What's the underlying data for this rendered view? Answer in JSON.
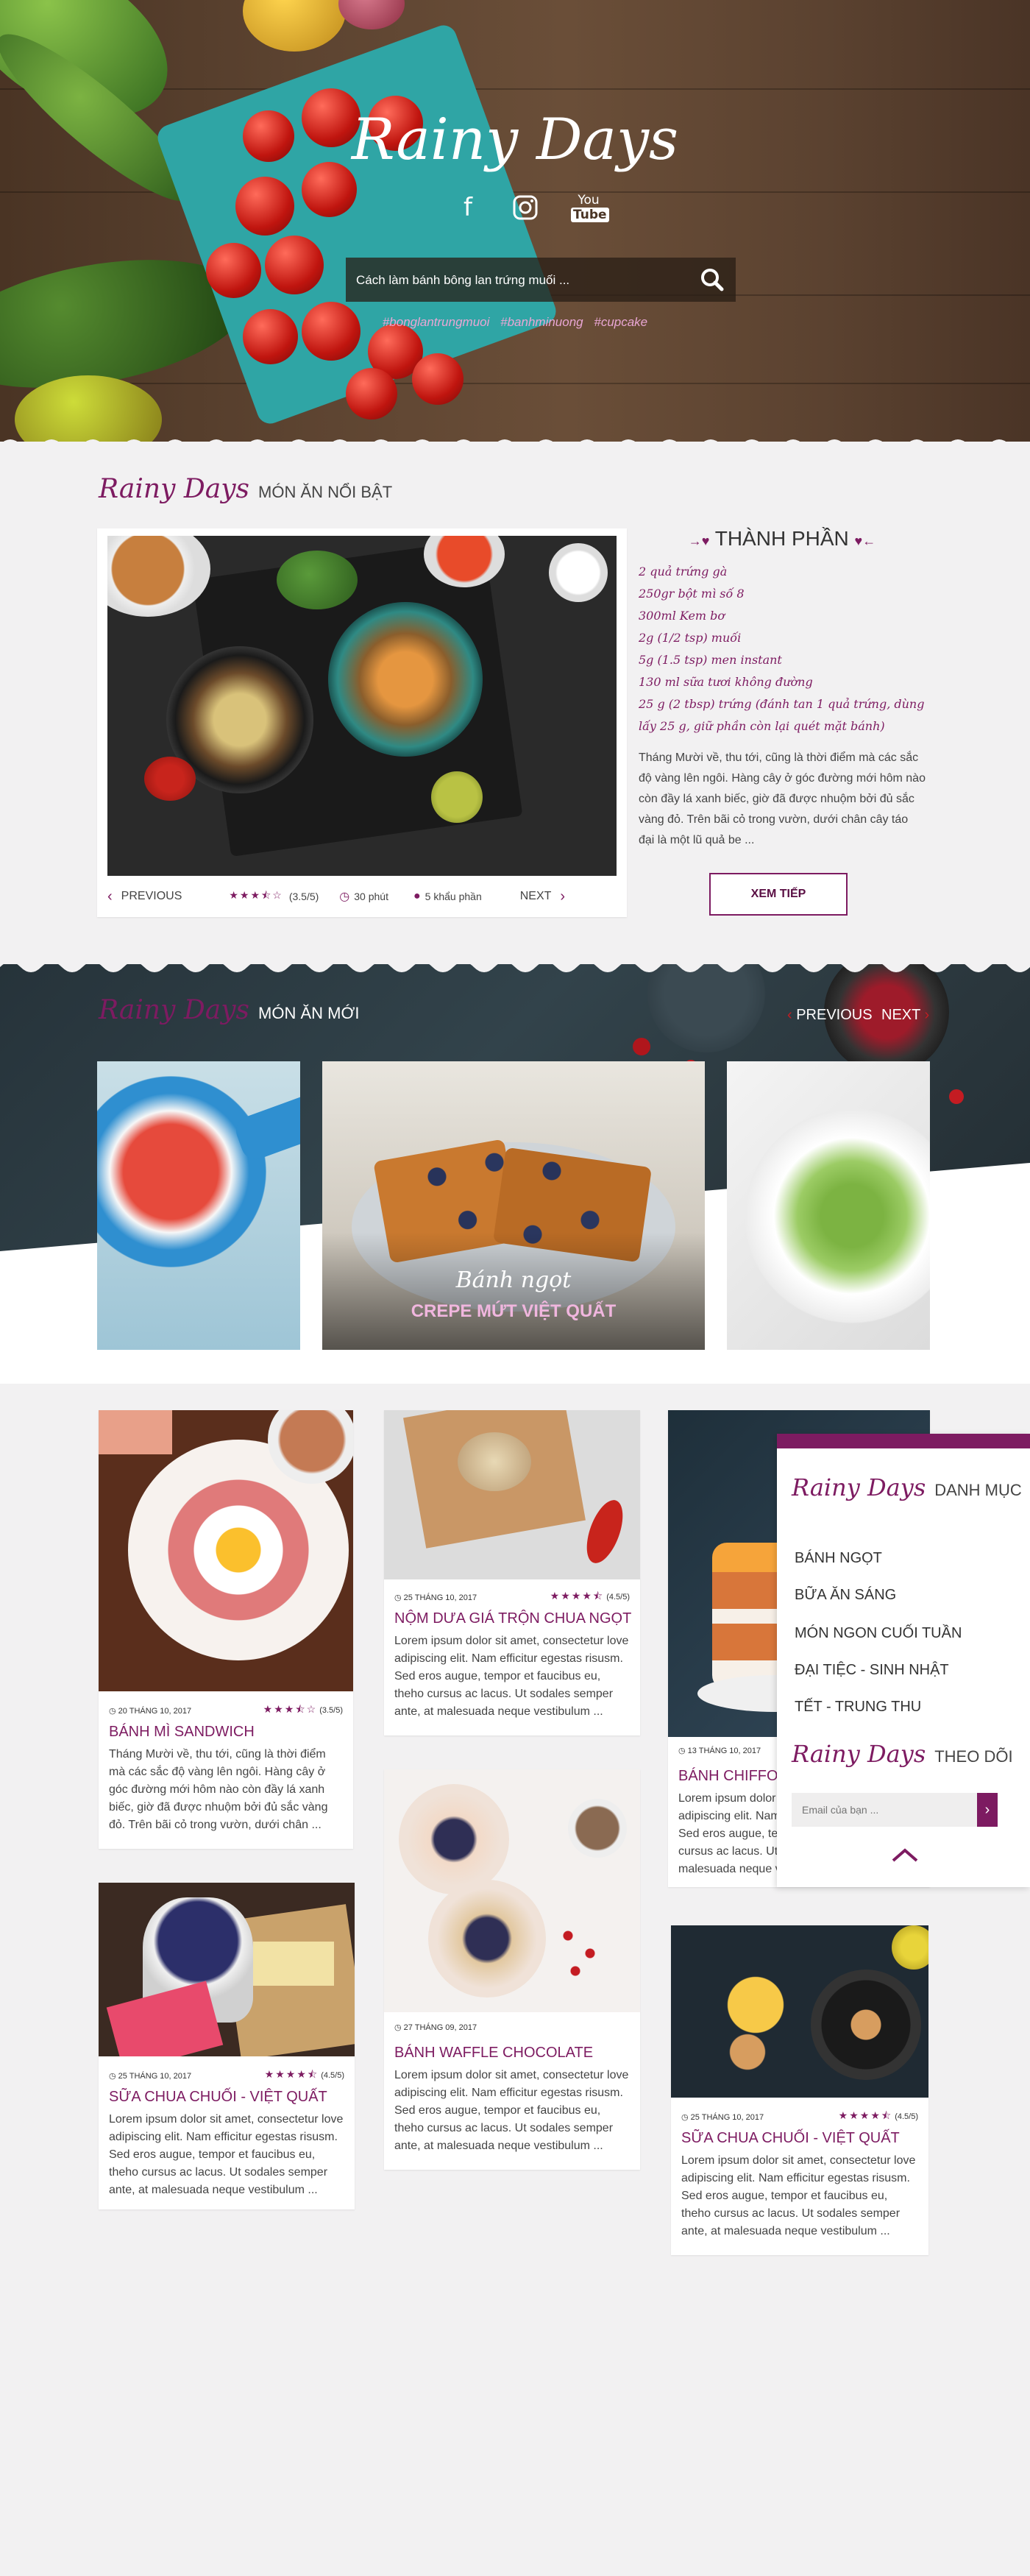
{
  "hero": {
    "title": "Rainy Days",
    "social": [
      "facebook-icon",
      "instagram-icon",
      "youtube-icon"
    ],
    "search_placeholder": "Cách làm bánh bông lan trứng muối ...",
    "tags": [
      "#bonglantrungmuoi",
      "#banhminuong",
      "#cupcake"
    ]
  },
  "featured": {
    "brand": "Rainy Days",
    "heading": "MÓN ĂN NỔI BẬT",
    "prev": "PREVIOUS",
    "next": "NEXT",
    "rating": 3.5,
    "rating_text": "(3.5/5)",
    "time": "30 phút",
    "servings": "5 khẩu phần",
    "ingredients_title": "THÀNH PHẦN",
    "ingredients": [
      "2 quả trứng gà",
      "250gr bột mì số 8",
      "300ml Kem bơ",
      "2g (1/2 tsp) muối",
      "5g (1.5 tsp) men instant",
      "130 ml sữa tươi không đường",
      "25 g (2 tbsp) trứng (đánh tan 1 quả trứng, dùng",
      "lấy 25 g, giữ phần còn lại quét mặt bánh)"
    ],
    "description": "Tháng Mười về, thu tới, cũng là thời điểm mà các sắc độ vàng lên ngôi. Hàng cây ở góc đường mới hôm nào còn đầy lá xanh biếc, giờ đã được nhuộm bởi đủ sắc vàng đỏ. Trên bãi cỏ trong vườn, dưới chân cây táo đại là một lũ quả be ...",
    "more_button": "XEM TIẾP"
  },
  "new_dishes": {
    "brand": "Rainy Days",
    "heading": "MÓN ĂN MỚI",
    "prev": "PREVIOUS",
    "next": "NEXT",
    "center_caption_script": "Bánh ngọt",
    "center_caption": "CREPE MỨT VIỆT QUẤT"
  },
  "posts": [
    {
      "date": "20 THÁNG 10, 2017",
      "rating": 3.5,
      "rating_text": "(3.5/5)",
      "title": "BÁNH MÌ SANDWICH",
      "body": "Tháng Mười về, thu tới, cũng là thời điểm mà các sắc độ vàng lên ngôi. Hàng cây ở góc đường mới hôm nào còn đầy lá xanh biếc, giờ đã được nhuộm bởi đủ sắc vàng đỏ. Trên bãi cỏ trong vườn, dưới chân ..."
    },
    {
      "date": "25 THÁNG 10, 2017",
      "rating": 4.5,
      "rating_text": "(4.5/5)",
      "title": "NỘM DƯA GIÁ TRỘN CHUA NGỌT",
      "body": "Lorem ipsum dolor sit amet, consectetur love adipiscing elit. Nam efficitur egestas risusm. Sed eros augue, tempor et faucibus eu, theho cursus ac lacus. Ut sodales semper ante, at malesuada neque vestibulum ..."
    },
    {
      "date": "13 THÁNG 10, 2017",
      "title": "BÁNH CHIFFON CA",
      "body": "Lorem ipsum dolor sit amet, consectetur love adipiscing elit. Nam efficitur egestas risusm. Sed eros augue, tempor et faucibus eu, theho cursus ac lacus. Ut sodales semper ante, at malesuada neque vestibulum ..."
    },
    {
      "date": "27 THÁNG 09, 2017",
      "rating": 4.5,
      "rating_text": "(4.5/5)",
      "title": "BÁNH WAFFLE CHOCOLATE",
      "body": "Lorem ipsum dolor sit amet, consectetur love adipiscing elit. Nam efficitur egestas risusm. Sed eros augue, tempor et faucibus eu, theho cursus ac lacus. Ut sodales semper ante, at malesuada neque vestibulum ..."
    },
    {
      "date": "25 THÁNG 10, 2017",
      "rating": 4.5,
      "rating_text": "(4.5/5)",
      "title": "SỮA CHUA CHUỐI - VIỆT QUẤT",
      "body": "Lorem ipsum dolor sit amet, consectetur love adipiscing elit. Nam efficitur egestas risusm. Sed eros augue, tempor et faucibus eu, theho cursus ac lacus. Ut sodales semper ante, at malesuada neque vestibulum ..."
    },
    {
      "date": "25 THÁNG 10, 2017",
      "rating": 4.5,
      "rating_text": "(4.5/5)",
      "title": "SỮA CHUA CHUỐI - VIỆT QUẤT",
      "body": "Lorem ipsum dolor sit amet, consectetur love adipiscing elit. Nam efficitur egestas risusm. Sed eros augue, tempor et faucibus eu, theho cursus ac lacus. Ut sodales semper ante, at malesuada neque vestibulum ..."
    }
  ],
  "sidebar": {
    "brand": "Rainy Days",
    "categories_heading": "DANH MỤC",
    "categories": [
      "BÁNH NGỌT",
      "BỮA ĂN SÁNG",
      "MÓN NGON CUỐI TUẦN",
      "ĐẠI TIỆC - SINH NHẬT",
      "TẾT - TRUNG THU"
    ],
    "follow_heading": "THEO DÕI",
    "email_placeholder": "Email của bạn ..."
  },
  "colors": {
    "accent": "#7d1b61",
    "tag": "#e9a6d4"
  }
}
